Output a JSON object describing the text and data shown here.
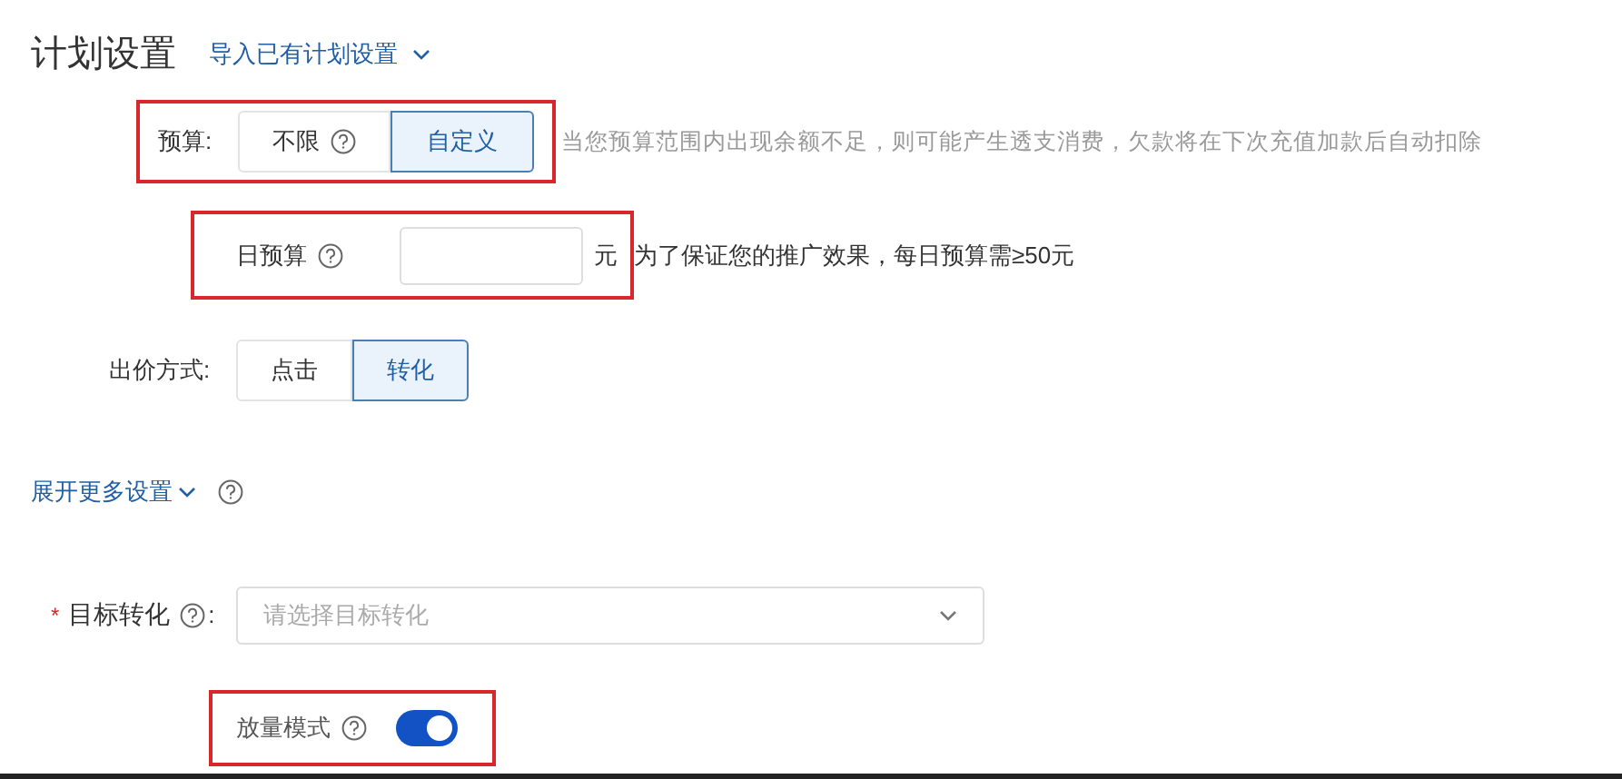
{
  "title": "计划设置",
  "import_link": {
    "label": "导入已有计划设置"
  },
  "budget": {
    "label": "预算:",
    "highlighted": true,
    "options": [
      {
        "label": "不限",
        "help": true,
        "selected": false
      },
      {
        "label": "自定义",
        "help": false,
        "selected": true
      }
    ],
    "hint": "当您预算范围内出现余额不足，则可能产生透支消费，欠款将在下次充值加款后自动扣除"
  },
  "daily_budget": {
    "label": "日预算",
    "highlighted": true,
    "unit": "元",
    "hint": "为了保证您的推广效果，每日预算需≥50元"
  },
  "bid_method": {
    "label": "出价方式:",
    "options": [
      {
        "label": "点击",
        "selected": false
      },
      {
        "label": "转化",
        "selected": true
      }
    ]
  },
  "more_settings": {
    "label": "展开更多设置"
  },
  "target_conversion": {
    "required_mark": "*",
    "label": "目标转化",
    "suffix": ":",
    "placeholder": "请选择目标转化"
  },
  "volume_mode": {
    "label": "放量模式",
    "highlighted": true,
    "on": true
  }
}
